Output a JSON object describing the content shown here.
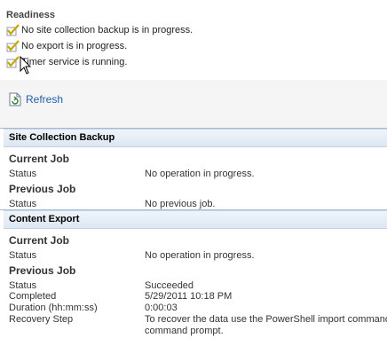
{
  "readiness": {
    "title": "Readiness",
    "items": [
      "No site collection backup is in progress.",
      "No export is in progress.",
      "Timer service is running."
    ]
  },
  "refresh": {
    "label": "Refresh"
  },
  "site_collection_backup": {
    "header": "Site Collection Backup",
    "current_job": {
      "title": "Current Job",
      "status_label": "Status",
      "status_value": "No operation in progress."
    },
    "previous_job": {
      "title": "Previous Job",
      "status_label": "Status",
      "status_value": "No previous job."
    }
  },
  "content_export": {
    "header": "Content Export",
    "current_job": {
      "title": "Current Job",
      "status_label": "Status",
      "status_value": "No operation in progress."
    },
    "previous_job": {
      "title": "Previous Job",
      "rows": [
        {
          "label": "Status",
          "value": "Succeeded"
        },
        {
          "label": "Completed",
          "value": "5/29/2011 10:18 PM"
        },
        {
          "label": "Duration (hh:mm:ss)",
          "value": "0:00:03"
        },
        {
          "label": "Recovery Step",
          "value": "To recover the data use the PowerShell import command"
        }
      ],
      "recovery_continuation": "command prompt."
    }
  }
}
